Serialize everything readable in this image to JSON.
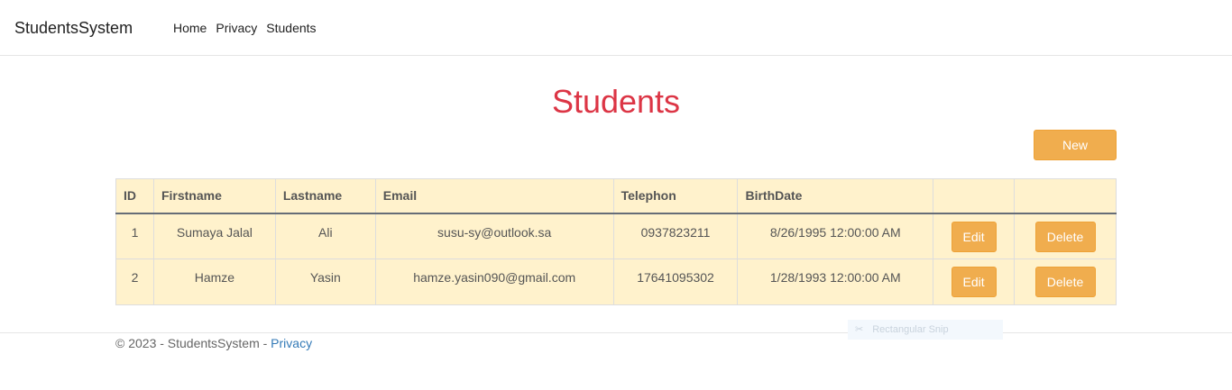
{
  "navbar": {
    "brand": "StudentsSystem",
    "links": [
      "Home",
      "Privacy",
      "Students"
    ]
  },
  "page": {
    "title": "Students",
    "new_button": "New"
  },
  "table": {
    "headers": [
      "ID",
      "Firstname",
      "Lastname",
      "Email",
      "Telephon",
      "BirthDate",
      "",
      ""
    ],
    "rows": [
      {
        "id": "1",
        "firstname": "Sumaya Jalal",
        "lastname": "Ali",
        "email": "susu-sy@outlook.sa",
        "telephon": "0937823211",
        "birthdate": "8/26/1995 12:00:00 AM",
        "edit": "Edit",
        "delete": "Delete"
      },
      {
        "id": "2",
        "firstname": "Hamze",
        "lastname": "Yasin",
        "email": "hamze.yasin090@gmail.com",
        "telephon": "17641095302",
        "birthdate": "1/28/1993 12:00:00 AM",
        "edit": "Edit",
        "delete": "Delete"
      }
    ]
  },
  "footer": {
    "text": "© 2023 - StudentsSystem - ",
    "link": "Privacy"
  },
  "overlay": {
    "icon": "scissors-icon",
    "label": "Rectangular Snip"
  },
  "colors": {
    "title": "#dc3545",
    "button": "#f0ad4e",
    "table_bg": "#fff2cc",
    "link": "#337ab7"
  }
}
